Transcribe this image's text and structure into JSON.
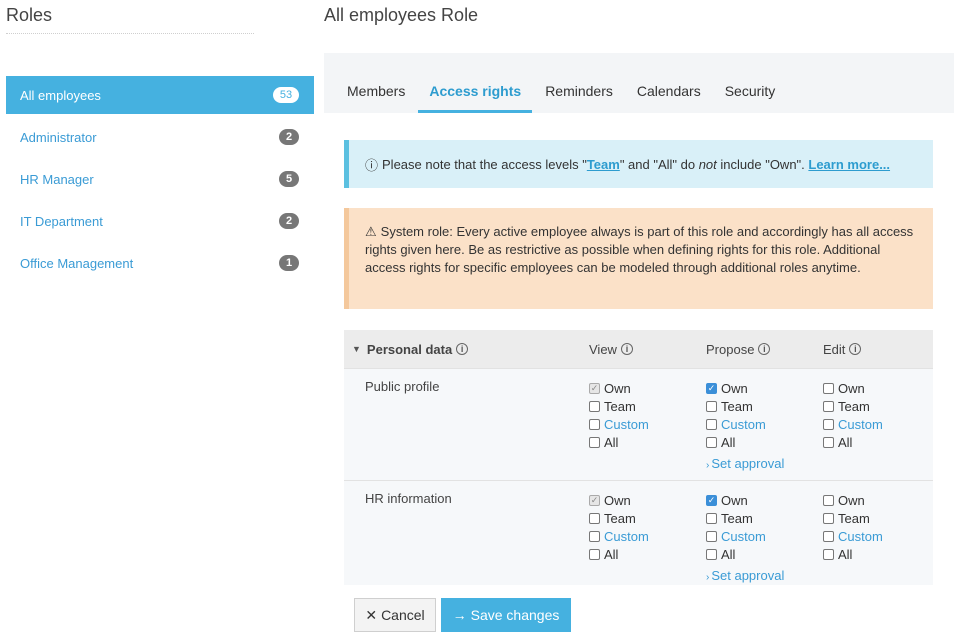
{
  "left": {
    "title": "Roles",
    "roles": [
      {
        "name": "All employees",
        "count": "53"
      },
      {
        "name": "Administrator",
        "count": "2"
      },
      {
        "name": "HR Manager",
        "count": "5"
      },
      {
        "name": "IT Department",
        "count": "2"
      },
      {
        "name": "Office Management",
        "count": "1"
      }
    ]
  },
  "main": {
    "title": "All employees Role",
    "tabs": [
      "Members",
      "Access rights",
      "Reminders",
      "Calendars",
      "Security"
    ],
    "active_tab": "Access rights"
  },
  "info": {
    "icon": "info-circle-icon",
    "t1": "Please note that the access levels \"",
    "link_team": "Team",
    "t2": "\" and \"All\" do ",
    "em": "not",
    "t3": " include \"Own\". ",
    "link_learn": "Learn more..."
  },
  "warning": {
    "icon": "warning-triangle-icon",
    "text": "System role: Every active employee always is part of this role and accordingly has all access rights given here. Be as restrictive as possible when defining rights for this role. Additional access rights for specific employees can be modeled through additional roles anytime."
  },
  "rights": {
    "section": "Personal data",
    "headers": {
      "view": "View",
      "propose": "Propose",
      "edit": "Edit"
    },
    "option_labels": {
      "own": "Own",
      "team": "Team",
      "custom": "Custom",
      "all": "All"
    },
    "set_approval": "Set approval",
    "rows": [
      {
        "label": "Public profile",
        "view_own": "checked-disabled",
        "propose_own": "checked",
        "edit_own": "unchecked"
      },
      {
        "label": "HR information",
        "view_own": "checked-disabled",
        "propose_own": "checked",
        "edit_own": "unchecked"
      }
    ]
  },
  "footer": {
    "cancel": "Cancel",
    "save": "Save changes"
  },
  "colors": {
    "accent": "#45b1e0",
    "link": "#3a9bd5",
    "info_bg": "#d9f0f8",
    "warning_bg": "#fbe1c8",
    "checkbox_checked": "#3b8fd8"
  }
}
